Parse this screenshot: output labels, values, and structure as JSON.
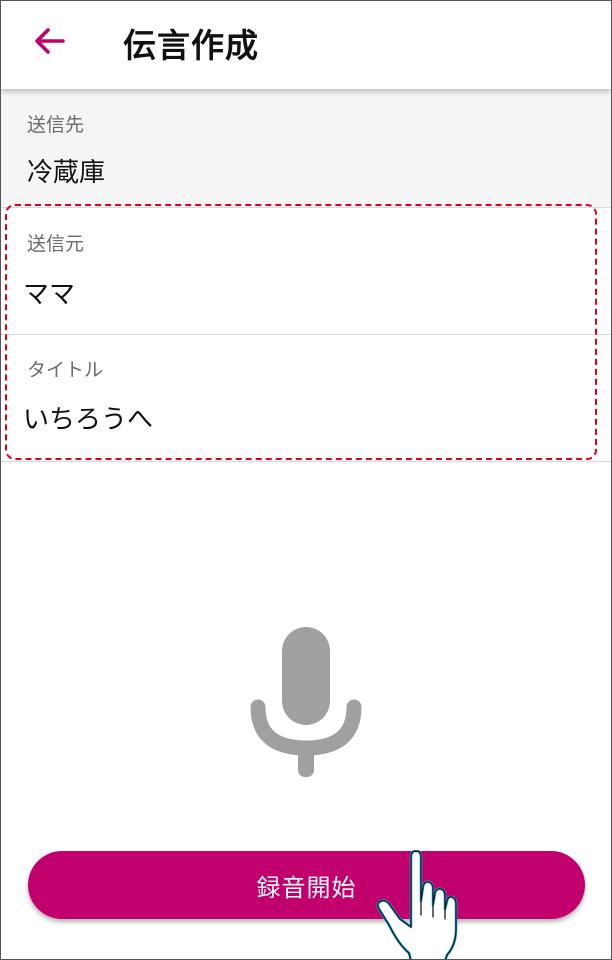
{
  "header": {
    "back_icon": "arrow-left-icon",
    "title": "伝言作成"
  },
  "form": {
    "destination": {
      "label": "送信先",
      "value": "冷蔵庫"
    },
    "sender": {
      "label": "送信元",
      "value": "ママ"
    },
    "subject": {
      "label": "タイトル",
      "value": "いちろうへ"
    }
  },
  "mic_icon": "microphone-icon",
  "record_button": {
    "label": "録音開始"
  },
  "pointer_icon": "hand-pointer-icon",
  "colors": {
    "accent": "#c2006d",
    "highlight_border": "#e0001a",
    "mic": "#a0a0a0",
    "pointer_outline": "#1ea7e1"
  }
}
